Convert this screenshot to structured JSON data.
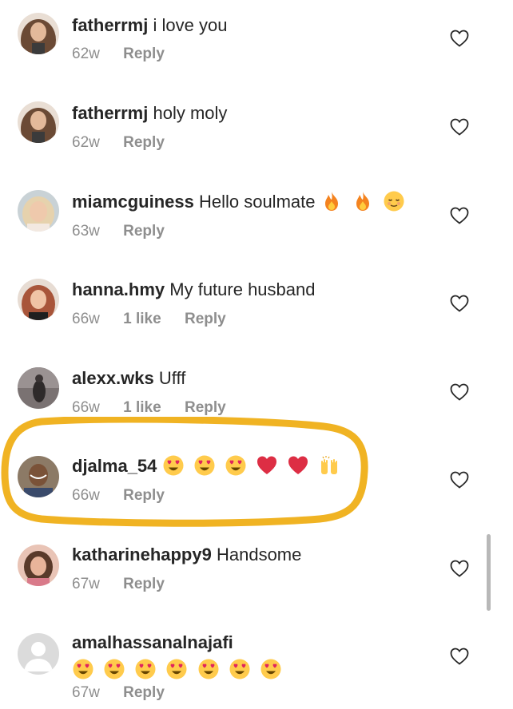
{
  "comments": [
    {
      "username": "fatherrmj",
      "text": "i love you",
      "age": "62w",
      "likes": "",
      "reply_label": "Reply",
      "avatar": "woman-long-brown-hair-avatar",
      "avatar_color": "#8a6a52"
    },
    {
      "username": "fatherrmj",
      "text": "holy moly",
      "age": "62w",
      "likes": "",
      "reply_label": "Reply",
      "avatar": "woman-long-brown-hair-avatar",
      "avatar_color": "#8a6a52"
    },
    {
      "username": "miamcguiness",
      "text": "Hello soulmate",
      "emojis": [
        "fire",
        "fire",
        "relieved-face"
      ],
      "age": "63w",
      "likes": "",
      "reply_label": "Reply",
      "avatar": "woman-blonde-avatar",
      "avatar_color": "#d9c7b0"
    },
    {
      "username": "hanna.hmy",
      "text": "My future husband",
      "age": "66w",
      "likes": "1 like",
      "reply_label": "Reply",
      "avatar": "woman-red-hair-avatar",
      "avatar_color": "#c98d6b"
    },
    {
      "username": "alexx.wks",
      "text": "Ufff",
      "age": "66w",
      "likes": "1 like",
      "reply_label": "Reply",
      "avatar": "mirror-selfie-avatar",
      "avatar_color": "#5b5454"
    },
    {
      "username": "djalma_54",
      "text": "",
      "emojis": [
        "heart-eyes",
        "heart-eyes",
        "heart-eyes",
        "red-heart",
        "red-heart",
        "raising-hands"
      ],
      "age": "66w",
      "likes": "",
      "reply_label": "Reply",
      "avatar": "man-smiling-avatar",
      "avatar_color": "#6f5a48",
      "highlighted": true
    },
    {
      "username": "katharinehappy9",
      "text": "Handsome",
      "age": "67w",
      "likes": "",
      "reply_label": "Reply",
      "avatar": "woman-smiling-avatar",
      "avatar_color": "#d8a48f"
    },
    {
      "username": "amalhassanalnajafi",
      "text": "",
      "emojis": [
        "heart-eyes",
        "heart-eyes",
        "heart-eyes",
        "heart-eyes",
        "heart-eyes",
        "heart-eyes",
        "heart-eyes"
      ],
      "age": "67w",
      "likes": "",
      "reply_label": "Reply",
      "avatar": "default-user-avatar",
      "avatar_color": "#dbdbdb"
    }
  ],
  "icons": {
    "like": "heart-outline-icon"
  },
  "colors": {
    "highlight": "#f0b323",
    "secondary_text": "#8e8e8e",
    "primary_text": "#262626",
    "scrollbar": "#b8b8b8"
  }
}
